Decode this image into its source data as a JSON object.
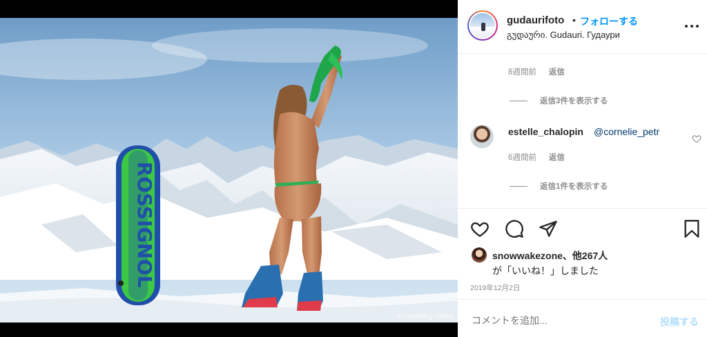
{
  "photo": {
    "credit": "©Lisetskiy Dima",
    "board_text": "ROSSIGNOL"
  },
  "header": {
    "username": "gudaurifoto",
    "separator": "•",
    "follow_label": "フォローする",
    "location": "გუდაური. Gudauri. Гудаури"
  },
  "comments": {
    "first_meta": {
      "time": "8週間前",
      "reply": "返信"
    },
    "first_view_replies": "返信3件を表示する",
    "second": {
      "username": "estelle_chalopin",
      "mention": "@cornelie_petr",
      "time": "6週間前",
      "reply": "返信",
      "view_replies": "返信1件を表示する"
    }
  },
  "likes": {
    "line1": "snowwakezone、他267人",
    "line2": "が「いいね！」しました"
  },
  "date": "2019年12月2日",
  "comment_box": {
    "placeholder": "コメントを追加...",
    "post_label": "投稿する"
  },
  "colors": {
    "accent": "#0095f6",
    "post_disabled": "#b2dffc",
    "board_green": "#3fd43a",
    "board_blue": "#1f4fa8"
  },
  "icons": [
    "heart-icon",
    "comment-icon",
    "share-icon",
    "bookmark-icon",
    "more-options-icon"
  ]
}
